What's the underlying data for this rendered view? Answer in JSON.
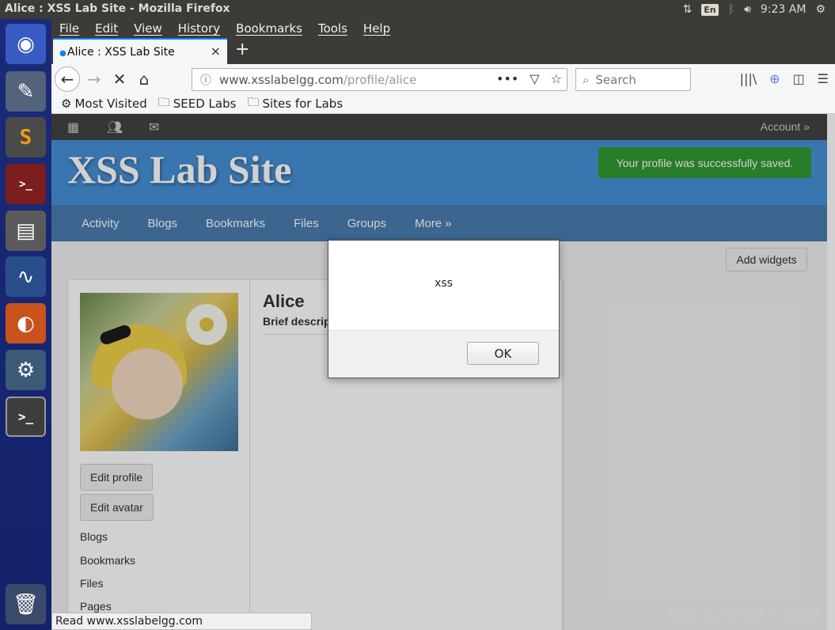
{
  "window": {
    "title": "Alice : XSS Lab Site - Mozilla Firefox",
    "time": "9:23 AM",
    "keyboard": "En"
  },
  "launcher": {
    "items": [
      "ubuntu-icon",
      "text-editor-icon",
      "sublime-icon",
      "terminal-red-icon",
      "file-cabinet-icon",
      "wireshark-icon",
      "firefox-icon",
      "settings-icon",
      "terminal-icon",
      "trash-icon"
    ]
  },
  "menubar": {
    "items": [
      "File",
      "Edit",
      "View",
      "History",
      "Bookmarks",
      "Tools",
      "Help"
    ]
  },
  "tab": {
    "label": "Alice : XSS Lab Site",
    "close": "×",
    "new": "+"
  },
  "urlbar": {
    "host": "www.xsslabelgg.com",
    "path": "/profile/alice",
    "dots": "•••"
  },
  "search": {
    "placeholder": "Search"
  },
  "bookmarks": [
    "Most Visited",
    "SEED Labs",
    "Sites for Labs"
  ],
  "site": {
    "account": "Account »",
    "title": "XSS Lab Site",
    "saved_message": "Your profile was successfully saved.",
    "nav": [
      "Activity",
      "Blogs",
      "Bookmarks",
      "Files",
      "Groups",
      "More »"
    ],
    "add_widgets": "Add widgets",
    "profile_name": "Alice",
    "brief": "Brief description:",
    "edit_profile": "Edit profile",
    "edit_avatar": "Edit avatar",
    "links": [
      "Blogs",
      "Bookmarks",
      "Files",
      "Pages"
    ]
  },
  "alert": {
    "message": "xss",
    "ok": "OK"
  },
  "status": "Read www.xsslabelgg.com",
  "watermark": "CSDN @20232831袁思承"
}
